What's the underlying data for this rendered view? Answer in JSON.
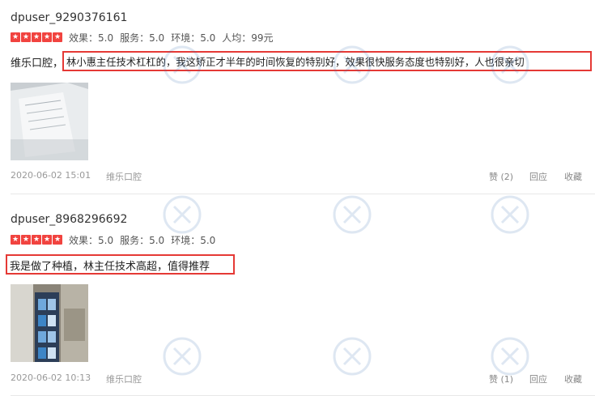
{
  "reviews": [
    {
      "username": "dpuser_9290376161",
      "ratings": {
        "effect": "效果：5.0",
        "service": "服务：5.0",
        "environment": "环境：5.0",
        "per_person": "人均：99元"
      },
      "content_prefix": "维乐口腔，",
      "content_highlight": "林小惠主任技术杠杠的，我这矫正才半年的时间恢复的特别好，效果很快服务态度也特别好，人也很亲切",
      "date": "2020-06-02 15:01",
      "shop": "维乐口腔",
      "like": "赞 (2)",
      "reply": "回应",
      "favorite": "收藏"
    },
    {
      "username": "dpuser_8968296692",
      "ratings": {
        "effect": "效果：5.0",
        "service": "服务：5.0",
        "environment": "环境：5.0"
      },
      "content_highlight": "我是做了种植，林主任技术高超，值得推荐",
      "date": "2020-06-02 10:13",
      "shop": "维乐口腔",
      "like": "赞 (1)",
      "reply": "回应",
      "favorite": "收藏"
    }
  ],
  "colors": {
    "highlight_border": "#e53935",
    "star_red": "#f1433f"
  }
}
